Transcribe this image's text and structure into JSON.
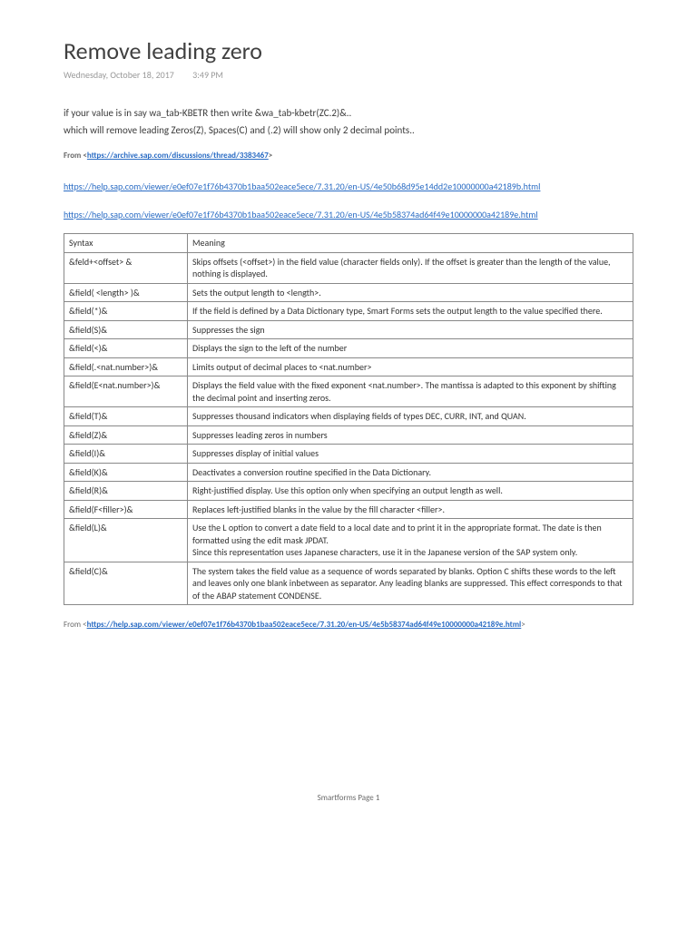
{
  "title": "Remove leading zero",
  "date": "Wednesday, October 18, 2017",
  "time": "3:49 PM",
  "para1": "if your value is in say wa_tab-KBETR then write &wa_tab-kbetr(ZC.2)&..",
  "para2": "which will remove leading Zeros(Z), Spaces(C) and (.2) will show only 2 decimal points..",
  "from1_prefix": "From <",
  "from1_link": "https://archive.sap.com/discussions/thread/3383467",
  "from1_suffix": ">",
  "link1": "https://help.sap.com/viewer/e0ef07e1f76b4370b1baa502eace5ece/7.31.20/en-US/4e50b68d95e14dd2e10000000a42189b.html",
  "link2": "https://help.sap.com/viewer/e0ef07e1f76b4370b1baa502eace5ece/7.31.20/en-US/4e5b58374ad64f49e10000000a42189e.html",
  "thead": {
    "c1": "Syntax",
    "c2": "Meaning"
  },
  "rows": [
    {
      "s": "&feld+<offset> &",
      "m": "Skips offsets (<offset>) in the field value (character fields only). If the offset is greater than the length of the value, nothing is displayed."
    },
    {
      "s": "&field( <length> )&",
      "m": "Sets the output length to <length>."
    },
    {
      "s": "&field(*)&",
      "m": "If the field is defined by a Data Dictionary type, Smart Forms sets the output length to the value specified there."
    },
    {
      "s": "&field(S)&",
      "m": "Suppresses the sign"
    },
    {
      "s": "&field(<)&",
      "m": "Displays the sign to the left of the number"
    },
    {
      "s": "&field(.<nat.number>)&",
      "m": "Limits output of decimal places to <nat.number>"
    },
    {
      "s": "&field(E<nat.number>)&",
      "m": "Displays the field value with the fixed exponent <nat.number>. The mantissa is adapted to this exponent by shifting the decimal point and inserting zeros."
    },
    {
      "s": "&field(T)&",
      "m": "Suppresses thousand indicators when displaying fields of types DEC, CURR, INT, and QUAN."
    },
    {
      "s": "&field(Z)&",
      "m": "Suppresses leading zeros in numbers"
    },
    {
      "s": "&field(I)&",
      "m": "Suppresses display of initial values"
    },
    {
      "s": "&field(K)&",
      "m": "Deactivates a conversion routine specified in the Data Dictionary."
    },
    {
      "s": "&field(R)&",
      "m": "Right-justified display. Use this option only when specifying an output length as well."
    },
    {
      "s": "&field(F<filler>)&",
      "m": "Replaces left-justified blanks in the value by the fill character <filler>."
    },
    {
      "s": "&field(L)&",
      "m": "Use the L option to convert a date field to a local date and to print it in the appropriate format. The date is then formatted using the edit mask JPDAT.\nSince this representation uses Japanese characters, use it in the Japanese version of the SAP system only."
    },
    {
      "s": "&field(C)&",
      "m": "The system takes the field value as a sequence of words separated by blanks. Option C shifts these words to the left and leaves only one blank inbetween as separator. Any leading blanks are suppressed. This effect corresponds to that of the ABAP statement CONDENSE."
    }
  ],
  "from2_prefix": "From <",
  "from2_link": "https://help.sap.com/viewer/e0ef07e1f76b4370b1baa502eace5ece/7.31.20/en-US/4e5b58374ad64f49e10000000a42189e.html",
  "from2_suffix": ">",
  "footer": "Smartforms Page 1"
}
